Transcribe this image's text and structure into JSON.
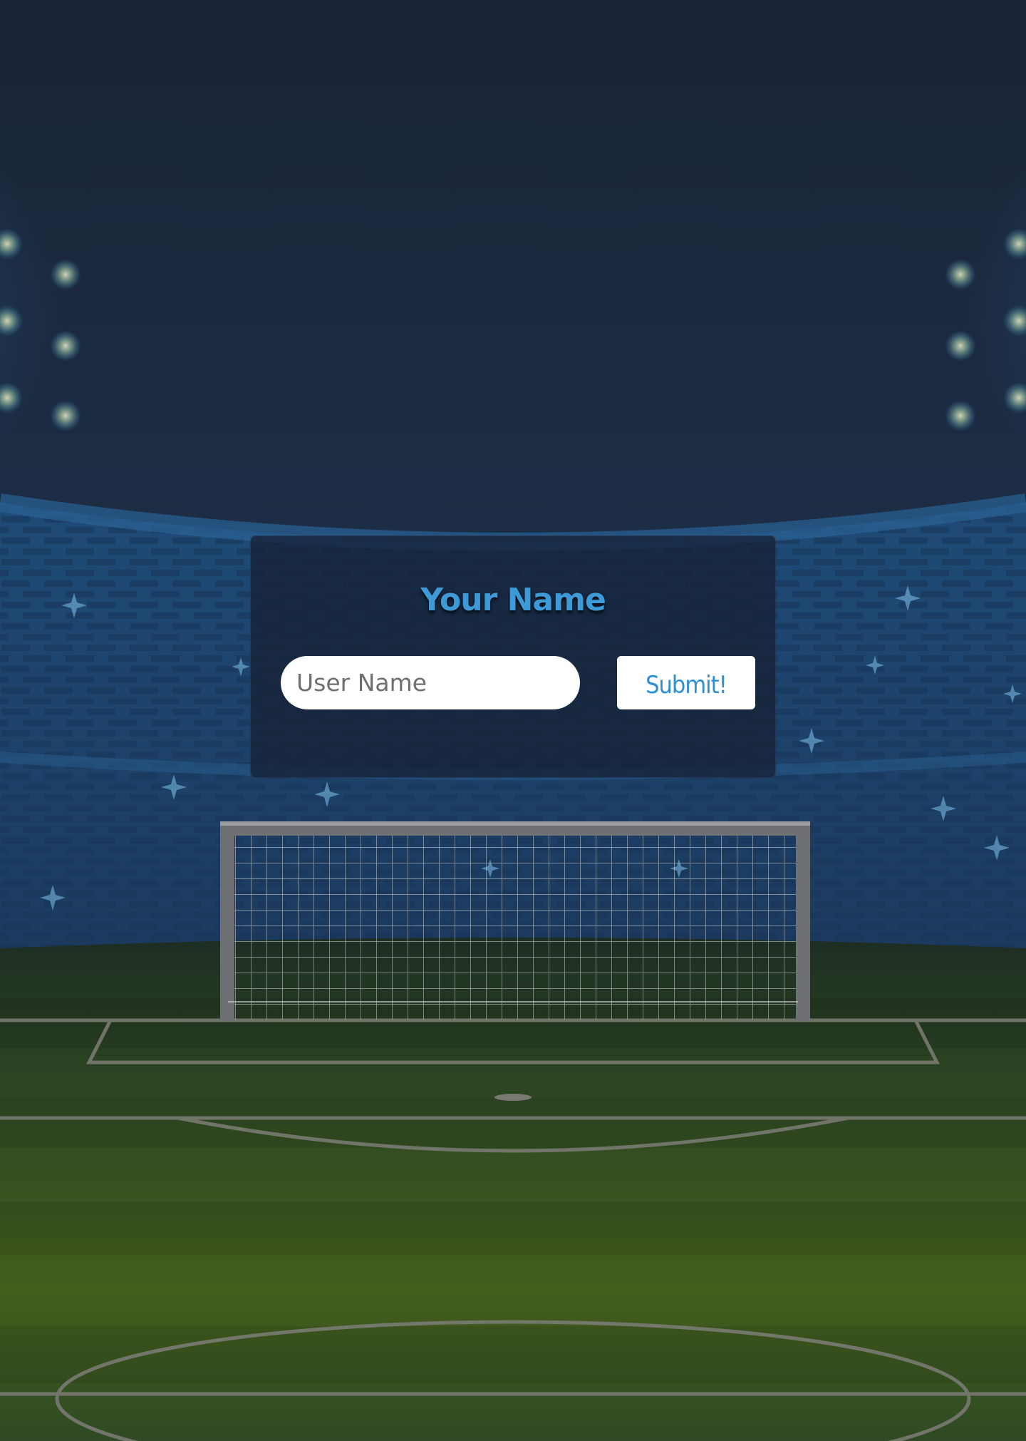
{
  "form": {
    "title": "Your Name",
    "input_placeholder": "User Name",
    "input_value": "",
    "submit_label": "Submit!"
  },
  "colors": {
    "title": "#3d9ad6",
    "button_text": "#2e8fd0",
    "sky": "#1b2538",
    "grass": "#3f5a1f"
  }
}
